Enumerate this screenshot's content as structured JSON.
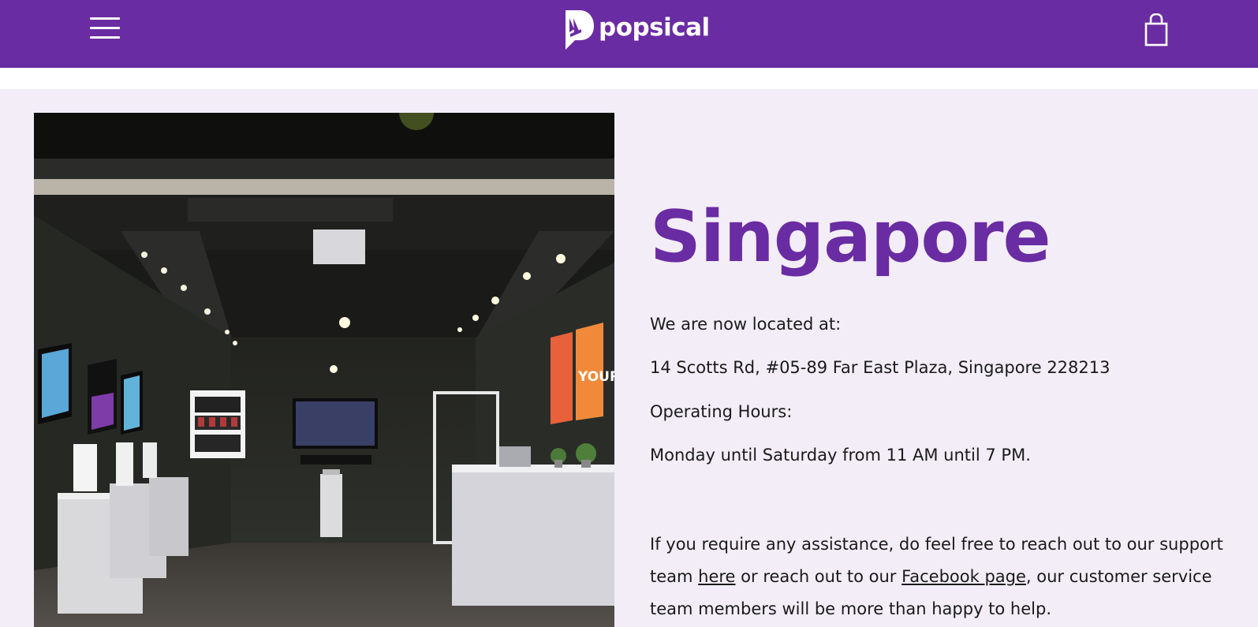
{
  "header": {
    "brand": "popsical",
    "menu_icon": "hamburger-menu-icon",
    "cart_icon": "shopping-bag-icon",
    "background_color": "#6a2ca2"
  },
  "store_photo": {
    "poster_text": "YOUR"
  },
  "location": {
    "title": "Singapore",
    "intro": "We are now located at:",
    "address": "14 Scotts Rd, #05-89 Far East Plaza, Singapore 228213",
    "hours_label": "Operating Hours:",
    "hours": "Monday until Saturday from 11 AM until 7 PM."
  },
  "assistance": {
    "text_1": "If you require any assistance, do feel free to reach out to our support team ",
    "link_here": "here",
    "text_2": " or reach out to our ",
    "link_facebook": "Facebook page",
    "text_3": ", our customer service team members will be more than happy to help."
  },
  "colors": {
    "accent": "#6a2ca2",
    "page_background": "#f2edf7"
  }
}
